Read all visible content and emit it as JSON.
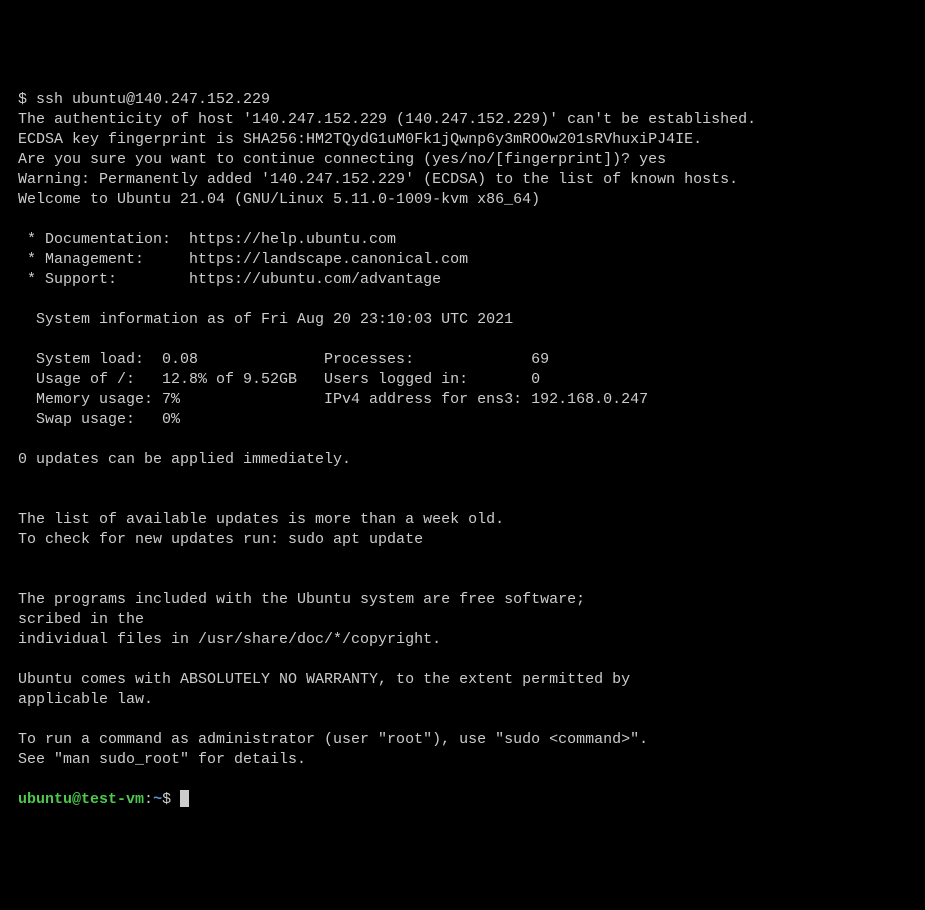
{
  "command": "$ ssh ubuntu@140.247.152.229",
  "auth_line1": "The authenticity of host '140.247.152.229 (140.247.152.229)' can't be established.",
  "auth_line2": "ECDSA key fingerprint is SHA256:HM2TQydG1uM0Fk1jQwnp6y3mROOw201sRVhuxiPJ4IE.",
  "auth_line3": "Are you sure you want to continue connecting (yes/no/[fingerprint])? yes",
  "auth_line4": "Warning: Permanently added '140.247.152.229' (ECDSA) to the list of known hosts.",
  "welcome": "Welcome to Ubuntu 21.04 (GNU/Linux 5.11.0-1009-kvm x86_64)",
  "links": {
    "doc": " * Documentation:  https://help.ubuntu.com",
    "mgmt": " * Management:     https://landscape.canonical.com",
    "support": " * Support:        https://ubuntu.com/advantage"
  },
  "sysinfo_header": "  System information as of Fri Aug 20 23:10:03 UTC 2021",
  "sysinfo": {
    "row1": "  System load:  0.08              Processes:             69",
    "row2": "  Usage of /:   12.8% of 9.52GB   Users logged in:       0",
    "row3": "  Memory usage: 7%                IPv4 address for ens3: 192.168.0.247",
    "row4": "  Swap usage:   0%"
  },
  "updates": "0 updates can be applied immediately.",
  "stale1": "The list of available updates is more than a week old.",
  "stale2": "To check for new updates run: sudo apt update",
  "legal1": "The programs included with the Ubuntu system are free software;",
  "legal2": "scribed in the",
  "legal3": "individual files in /usr/share/doc/*/copyright.",
  "warranty1": "Ubuntu comes with ABSOLUTELY NO WARRANTY, to the extent permitted by",
  "warranty2": "applicable law.",
  "sudo1": "To run a command as administrator (user \"root\"), use \"sudo <command>\".",
  "sudo2": "See \"man sudo_root\" for details.",
  "prompt": {
    "user": "ubuntu",
    "at": "@",
    "host": "test-vm",
    "colon": ":",
    "path": "~",
    "dollar": "$ "
  }
}
